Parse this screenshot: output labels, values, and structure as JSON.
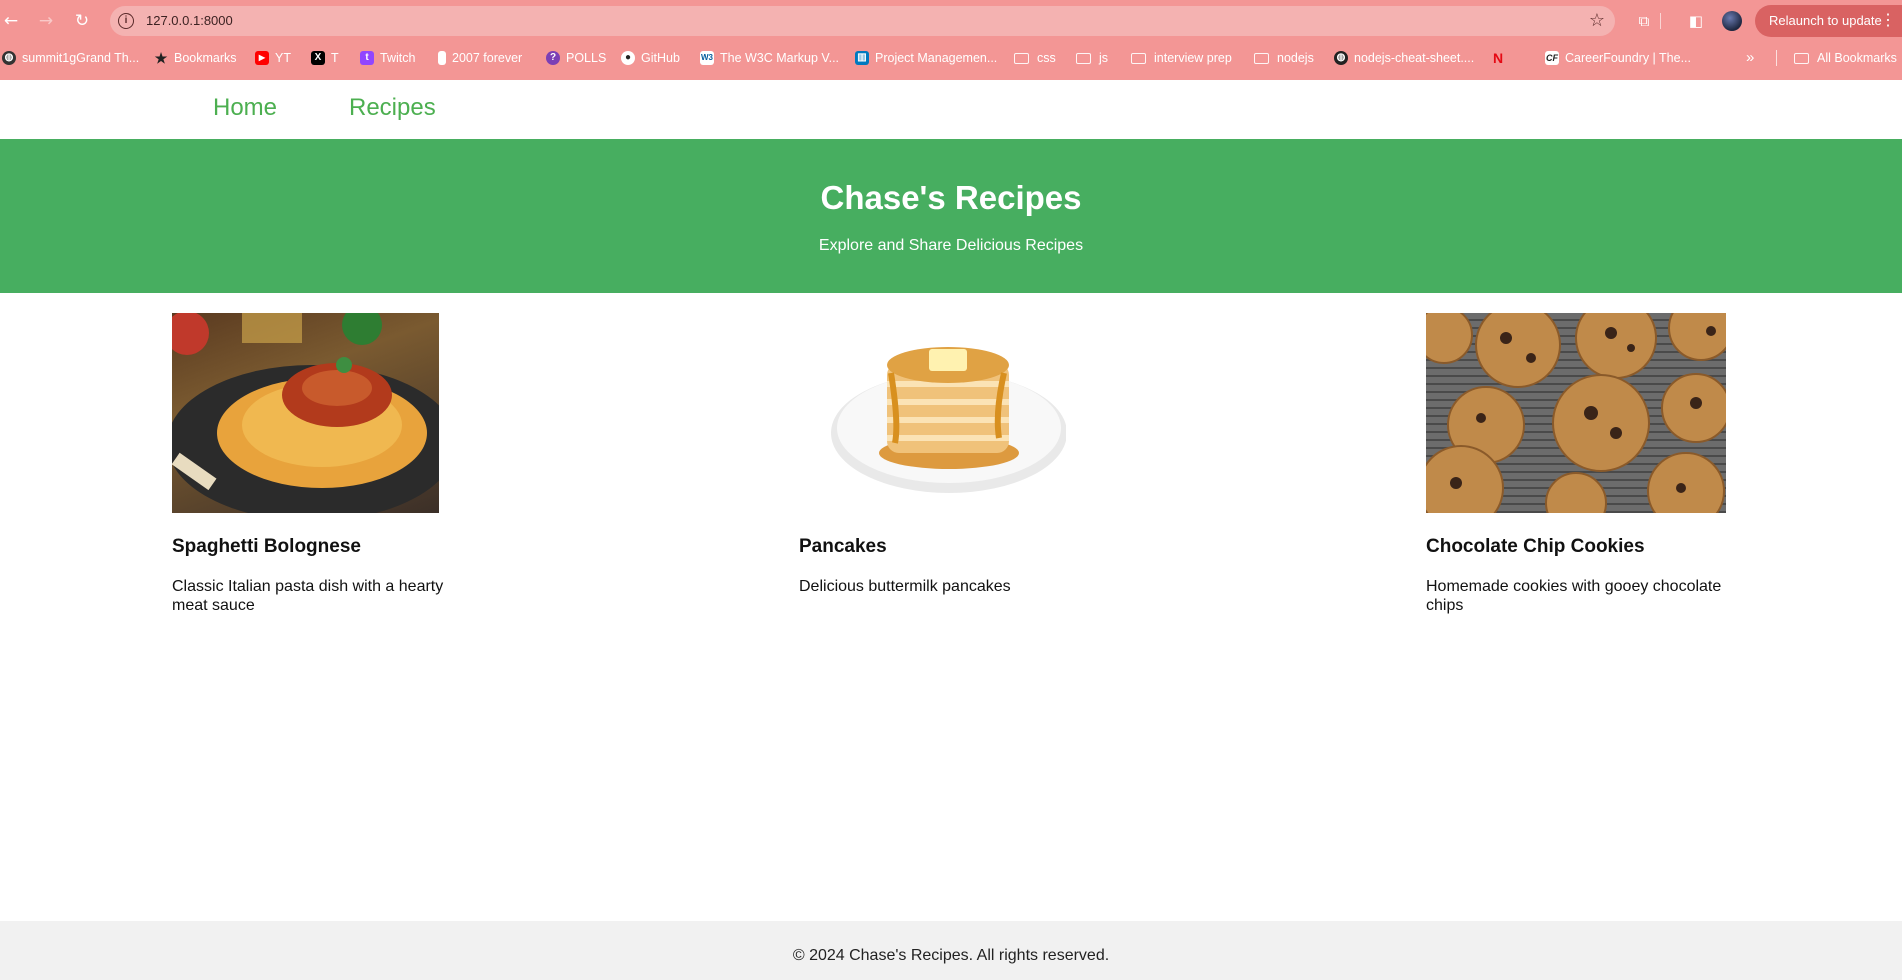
{
  "browser": {
    "url": "127.0.0.1:8000",
    "relaunch_label": "Relaunch to update",
    "theme_color": "#f39695",
    "bookmarks": [
      {
        "label": "summit1gGrand Th...",
        "icon": "globe-icon"
      },
      {
        "label": "Bookmarks",
        "icon": "star-icon"
      },
      {
        "label": "YT",
        "icon": "youtube-icon"
      },
      {
        "label": "T",
        "icon": "x-icon"
      },
      {
        "label": "Twitch",
        "icon": "twitch-icon"
      },
      {
        "label": "2007 forever",
        "icon": "phone-icon"
      },
      {
        "label": "POLLS",
        "icon": "poll-icon"
      },
      {
        "label": "GitHub",
        "icon": "github-icon"
      },
      {
        "label": "The W3C Markup V...",
        "icon": "w3c-icon"
      },
      {
        "label": "Project Managemen...",
        "icon": "trello-icon"
      },
      {
        "label": "css",
        "icon": "folder-icon"
      },
      {
        "label": "js",
        "icon": "folder-icon"
      },
      {
        "label": "interview prep",
        "icon": "folder-icon"
      },
      {
        "label": "nodejs",
        "icon": "folder-icon"
      },
      {
        "label": "nodejs-cheat-sheet....",
        "icon": "globe-icon"
      },
      {
        "label": "",
        "icon": "netflix-icon"
      },
      {
        "label": "CareerFoundry | The...",
        "icon": "careerfoundry-icon"
      }
    ],
    "all_bookmarks_label": "All Bookmarks"
  },
  "site": {
    "nav": {
      "home": "Home",
      "recipes": "Recipes"
    },
    "accent_color": "#47ae60",
    "hero": {
      "title": "Chase's Recipes",
      "subtitle": "Explore and Share Delicious Recipes"
    },
    "recipes": [
      {
        "title": "Spaghetti Bolognese",
        "description": "Classic Italian pasta dish with a hearty meat sauce",
        "image": "spaghetti-bolognese-photo"
      },
      {
        "title": "Pancakes",
        "description": "Delicious buttermilk pancakes",
        "image": "pancakes-photo"
      },
      {
        "title": "Chocolate Chip Cookies",
        "description": "Homemade cookies with gooey chocolate chips",
        "image": "cookies-photo"
      }
    ],
    "footer": "© 2024 Chase's Recipes. All rights reserved."
  }
}
